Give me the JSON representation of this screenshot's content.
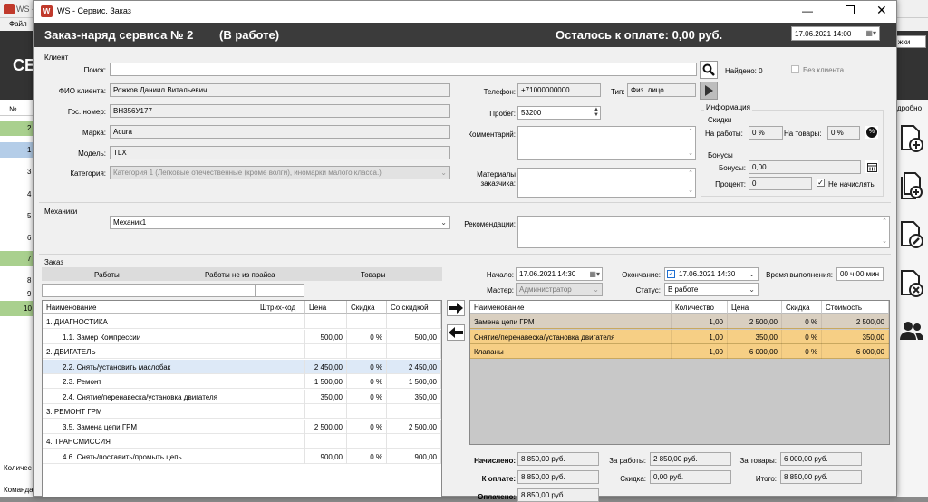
{
  "bg": {
    "title": "WS -",
    "menu_file": "Файл",
    "big_letters": "СЕ",
    "col_num": "№",
    "rows": [
      "2",
      "1",
      "3",
      "4",
      "5",
      "6",
      "7",
      "8",
      "9",
      "10"
    ],
    "right_label": "дробно",
    "right_combo": "жки",
    "status1": "Количес",
    "status2": "Команда"
  },
  "window": {
    "title": "WS - Сервис. Заказ",
    "app_icon": "ws-logo-icon"
  },
  "header": {
    "order_title": "Заказ-наряд сервиса № 2",
    "order_status": "(В работе)",
    "remaining": "Осталось к оплате: 0,00 руб.",
    "datetime": "17.06.2021 14:00"
  },
  "client": {
    "group_label": "Клиент",
    "search_label": "Поиск:",
    "search_value": "",
    "found_label": "Найдено: 0",
    "no_client_label": "Без клиента",
    "fio_label": "ФИО клиента:",
    "fio_value": "Рожков Даниил Витальевич",
    "gos_label": "Гос. номер:",
    "gos_value": "ВН356У177",
    "brand_label": "Марка:",
    "brand_value": "Acura",
    "model_label": "Модель:",
    "model_value": "TLX",
    "category_label": "Категория:",
    "category_value": "Категория 1 (Легковые отечественные (кроме волги), иномарки малого класса.)",
    "phone_label": "Телефон:",
    "phone_value": "+71000000000",
    "type_label": "Тип:",
    "type_value": "Физ. лицо",
    "mileage_label": "Пробег:",
    "mileage_value": "53200",
    "comment_label": "Комментарий:",
    "materials_label": "Материалы заказчика:"
  },
  "info": {
    "group_label": "Информация",
    "discounts_label": "Скидки",
    "works_label": "На работы:",
    "works_value": "0 %",
    "goods_label": "На товары:",
    "goods_value": "0 %",
    "bonus_label": "Бонусы",
    "bonus_field_label": "Бонусы:",
    "bonus_value": "0,00",
    "percent_label": "Процент:",
    "percent_value": "0",
    "no_accrue_label": "Не начислять"
  },
  "mechanics": {
    "group_label": "Механики",
    "value": "Механик1",
    "recommend_label": "Рекомендации:"
  },
  "order": {
    "group_label": "Заказ",
    "tabs": [
      "Работы",
      "Работы не из прайса",
      "Товары"
    ],
    "start_label": "Начало:",
    "start_value": "17.06.2021 14:30",
    "end_label": "Окончание:",
    "end_value": "17.06.2021 14:30",
    "duration_label": "Время выполнения:",
    "duration_value": "00 ч 00 мин",
    "master_label": "Мастер:",
    "master_value": "Администратор",
    "status_label": "Статус:",
    "status_value": "В работе"
  },
  "price_table": {
    "headers": [
      "Наименование",
      "Штрих-код",
      "Цена",
      "Скидка",
      "Со скидкой"
    ],
    "rows": [
      {
        "name": "1. ДИАГНОСТИКА",
        "barcode": "",
        "price": "",
        "discount": "",
        "total": "",
        "group": true
      },
      {
        "name": "1.1. Замер Компрессии",
        "barcode": "",
        "price": "500,00",
        "discount": "0 %",
        "total": "500,00",
        "group": false
      },
      {
        "name": "2. ДВИГАТЕЛЬ",
        "barcode": "",
        "price": "",
        "discount": "",
        "total": "",
        "group": true
      },
      {
        "name": "2.2. Снять/установить маслобак",
        "barcode": "",
        "price": "2 450,00",
        "discount": "0 %",
        "total": "2 450,00",
        "group": false,
        "selected": true
      },
      {
        "name": "2.3. Ремонт",
        "barcode": "",
        "price": "1 500,00",
        "discount": "0 %",
        "total": "1 500,00",
        "group": false
      },
      {
        "name": "2.4. Снятие/перенавеска/установка двигателя",
        "barcode": "",
        "price": "350,00",
        "discount": "0 %",
        "total": "350,00",
        "group": false
      },
      {
        "name": "3. РЕМОНТ ГРМ",
        "barcode": "",
        "price": "",
        "discount": "",
        "total": "",
        "group": true
      },
      {
        "name": "3.5. Замена цепи ГРМ",
        "barcode": "",
        "price": "2 500,00",
        "discount": "0 %",
        "total": "2 500,00",
        "group": false
      },
      {
        "name": "4. ТРАНСМИССИЯ",
        "barcode": "",
        "price": "",
        "discount": "",
        "total": "",
        "group": true
      },
      {
        "name": "4.6. Снять/поставить/промыть цепь",
        "barcode": "",
        "price": "900,00",
        "discount": "0 %",
        "total": "900,00",
        "group": false
      }
    ]
  },
  "order_table": {
    "headers": [
      "Наименование",
      "Количество",
      "Цена",
      "Скидка",
      "Стоимость"
    ],
    "rows": [
      {
        "name": "Замена цепи ГРМ",
        "qty": "1,00",
        "price": "2 500,00",
        "discount": "0 %",
        "cost": "2 500,00",
        "color": "#d9cfc0"
      },
      {
        "name": "Снятие/перенавеска/установка двигателя",
        "qty": "1,00",
        "price": "350,00",
        "discount": "0 %",
        "cost": "350,00",
        "color": "#f6cf85"
      },
      {
        "name": "Клапаны",
        "qty": "1,00",
        "price": "6 000,00",
        "discount": "0 %",
        "cost": "6 000,00",
        "color": "#f6cf85"
      }
    ]
  },
  "totals": {
    "accrued_label": "Начислено:",
    "accrued_value": "8 850,00 руб.",
    "works_label": "За работы:",
    "works_value": "2 850,00 руб.",
    "goods_label": "За товары:",
    "goods_value": "6 000,00 руб.",
    "topay_label": "К оплате:",
    "topay_value": "8 850,00 руб.",
    "discount_label": "Скидка:",
    "discount_value": "0,00 руб.",
    "total_label": "Итого:",
    "total_value": "8 850,00 руб.",
    "paid_label": "Оплачено:",
    "paid_value": "8 850,00 руб."
  }
}
